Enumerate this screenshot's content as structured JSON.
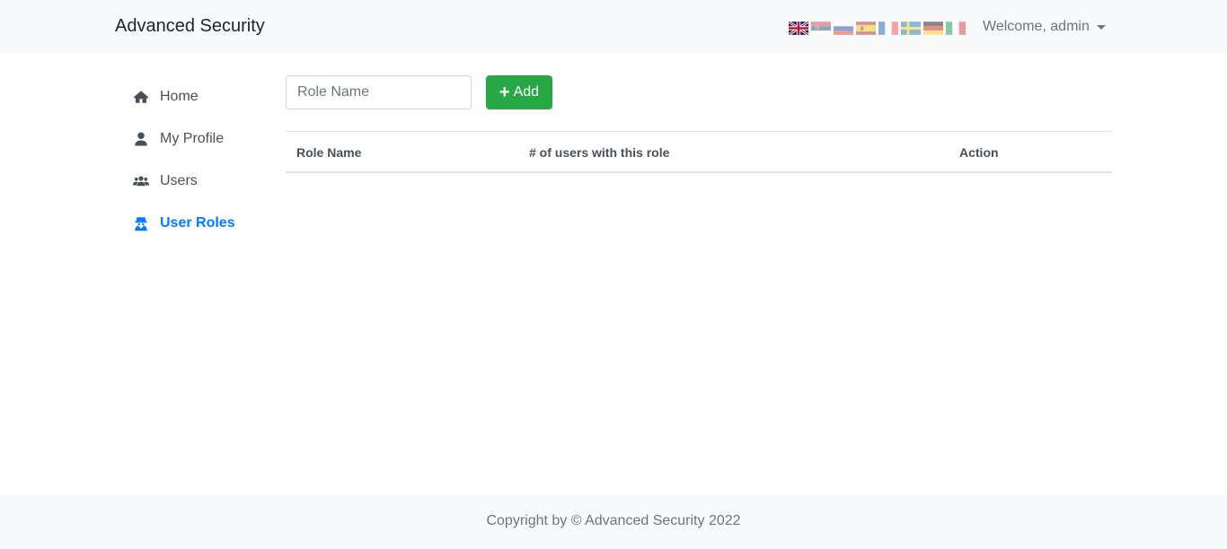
{
  "navbar": {
    "brand": "Advanced Security",
    "welcome": "Welcome, admin",
    "languages": [
      {
        "icon": "flag-uk-icon",
        "active": true
      },
      {
        "icon": "flag-serbia-icon",
        "active": false
      },
      {
        "icon": "flag-russia-icon",
        "active": false
      },
      {
        "icon": "flag-spain-icon",
        "active": false
      },
      {
        "icon": "flag-france-icon",
        "active": false
      },
      {
        "icon": "flag-sweden-icon",
        "active": false
      },
      {
        "icon": "flag-germany-icon",
        "active": false
      },
      {
        "icon": "flag-italy-icon",
        "active": false
      }
    ]
  },
  "sidebar": {
    "items": [
      {
        "label": "Home",
        "icon": "home-icon"
      },
      {
        "label": "My Profile",
        "icon": "user-icon"
      },
      {
        "label": "Users",
        "icon": "users-icon"
      },
      {
        "label": "User Roles",
        "icon": "user-secret-icon",
        "active": true
      }
    ]
  },
  "main": {
    "role_input": {
      "placeholder": "Role Name",
      "value": ""
    },
    "add_button": "Add",
    "table": {
      "columns": [
        "Role Name",
        "# of users with this role",
        "Action"
      ],
      "rows": []
    }
  },
  "footer": {
    "copyright": "Copyright by © Advanced Security 2022"
  },
  "colors": {
    "active_link": "#007bff",
    "add_button": "#28a745",
    "navbar_bg": "#f8f9fa"
  }
}
